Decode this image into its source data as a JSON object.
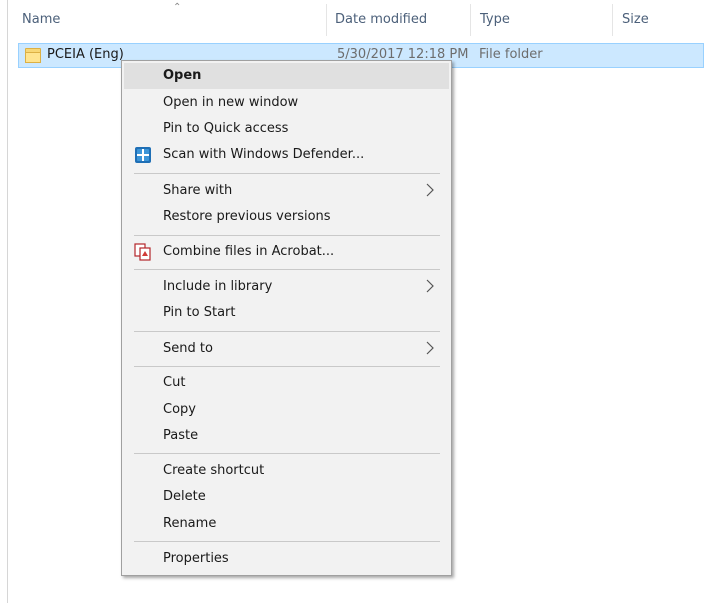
{
  "columns": {
    "name": "Name",
    "date_modified": "Date modified",
    "type": "Type",
    "size": "Size"
  },
  "file": {
    "name": "PCEIA (Eng)",
    "date_modified": "5/30/2017 12:18 PM",
    "type": "File folder",
    "icon": "folder-icon"
  },
  "context_menu": {
    "items": [
      {
        "label": "Open",
        "default": true
      },
      {
        "label": "Open in new window"
      },
      {
        "label": "Pin to Quick access"
      },
      {
        "label": "Scan with Windows Defender...",
        "icon": "windows-defender-icon"
      },
      {
        "label": "Share with",
        "submenu": true
      },
      {
        "label": "Restore previous versions"
      },
      {
        "label": "Combine files in Acrobat...",
        "icon": "acrobat-combine-icon"
      },
      {
        "label": "Include in library",
        "submenu": true
      },
      {
        "label": "Pin to Start"
      },
      {
        "label": "Send to",
        "submenu": true
      },
      {
        "label": "Cut"
      },
      {
        "label": "Copy"
      },
      {
        "label": "Paste"
      },
      {
        "label": "Create shortcut"
      },
      {
        "label": "Delete"
      },
      {
        "label": "Rename"
      },
      {
        "label": "Properties"
      }
    ]
  },
  "colors": {
    "selection_bg": "#cce8ff",
    "selection_border": "#99d1ff",
    "menu_bg": "#f2f2f2",
    "header_text": "#4c607a"
  }
}
